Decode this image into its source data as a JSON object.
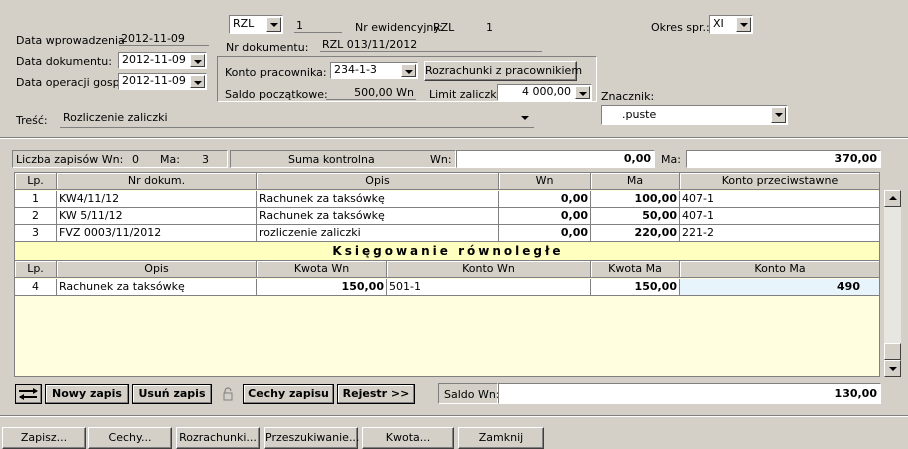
{
  "header": {
    "doc_type": "RZL",
    "doc_number": "1",
    "nr_ewidencyjny_label": "Nr ewidencyjny:",
    "nr_ewidencyjny_value": "RZL",
    "nr_ewidencyjny_num": "1",
    "okres_label": "Okres spr.:",
    "okres_value": "XI",
    "data_wprowadzenia_label": "Data wprowadzenia",
    "data_wprowadzenia": "2012-11-09",
    "data_dokumentu_label": "Data dokumentu:",
    "data_dokumentu": "2012-11-09",
    "data_operacji_label": "Data operacji gosp.:",
    "data_operacji": "2012-11-09",
    "nr_dokumentu_label": "Nr dokumentu:",
    "nr_dokumentu": "RZL 013/11/2012",
    "konto_pracownika_label": "Konto pracownika:",
    "konto_pracownika": "234-1-3",
    "rozrachunki_button": "Rozrachunki z pracownikiem",
    "saldo_poczatkowe_label": "Saldo początkowe:",
    "saldo_poczatkowe": "500,00 Wn",
    "limit_zaliczki_label": "Limit zaliczki:",
    "limit_zaliczki": "4 000,00",
    "znacznik_label": "Znacznik:",
    "znacznik_value": ".puste",
    "tresc_label": "Treść:",
    "tresc_value": "Rozliczenie zaliczki"
  },
  "summary": {
    "liczba_label": "Liczba zapisów Wn:",
    "liczba_wn": "0",
    "ma_label": "Ma:",
    "liczba_ma": "3",
    "suma_label": "Suma kontrolna",
    "wn_label": "Wn:",
    "suma_wn": "0,00",
    "ma2_label": "Ma:",
    "suma_ma": "370,00"
  },
  "table": {
    "headers": [
      "Lp.",
      "Nr dokum.",
      "Opis",
      "Wn",
      "Ma",
      "Konto przeciwstawne"
    ],
    "rows": [
      {
        "lp": "1",
        "nr": "KW4/11/12",
        "opis": "Rachunek za taksówkę",
        "wn": "0,00",
        "ma": "100,00",
        "konto": "407-1"
      },
      {
        "lp": "2",
        "nr": "KW 5/11/12",
        "opis": "Rachunek za taksówkę",
        "wn": "0,00",
        "ma": "50,00",
        "konto": "407-1"
      },
      {
        "lp": "3",
        "nr": "FVZ 0003/11/2012",
        "opis": "rozliczenie zaliczki",
        "wn": "0,00",
        "ma": "220,00",
        "konto": "221-2"
      }
    ]
  },
  "parallel": {
    "title": "Księgowanie równoległe",
    "headers": [
      "Lp.",
      "Opis",
      "Kwota Wn",
      "Konto Wn",
      "Kwota Ma",
      "Konto Ma"
    ],
    "rows": [
      {
        "lp": "4",
        "opis": "Rachunek za taksówkę",
        "kwota_wn": "150,00",
        "konto_wn": "501-1",
        "kwota_ma": "150,00",
        "konto_ma": "490"
      }
    ]
  },
  "toolbar": {
    "nowy_zapis": "Nowy zapis",
    "usun_zapis": "Usuń zapis",
    "cechy_zapisu": "Cechy zapisu",
    "rejestr": "Rejestr >>",
    "saldo_wn_label": "Saldo Wn:",
    "saldo_wn": "130,00"
  },
  "footer": {
    "zapisz": "Zapisz...",
    "cechy": "Cechy...",
    "rozrachunki": "Rozrachunki...",
    "przeszukiwanie": "Przeszukiwanie...",
    "kwota": "Kwota...",
    "zamknij": "Zamknij"
  }
}
